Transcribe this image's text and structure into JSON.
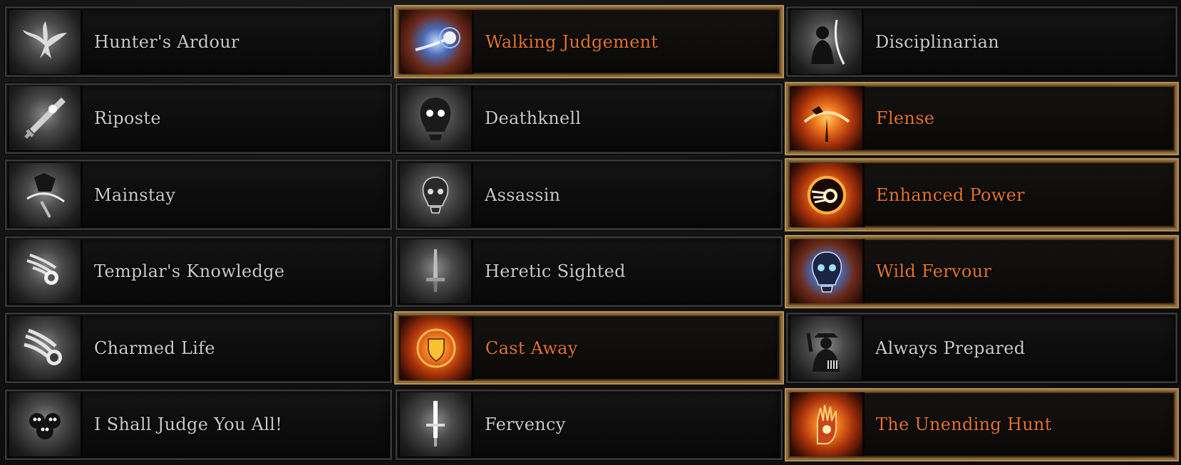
{
  "colors": {
    "inactive_text": "#c9c9c9",
    "active_text": "#e2732c",
    "active_border": "#b89258",
    "inactive_border": "#3a3a3a"
  },
  "perks": [
    {
      "label": "Hunter's Ardour",
      "icon": "dove-icon",
      "active": false
    },
    {
      "label": "Walking Judgement",
      "icon": "comet-icon",
      "active": true
    },
    {
      "label": "Disciplinarian",
      "icon": "silhouette-icon",
      "active": false
    },
    {
      "label": "Riposte",
      "icon": "sword-icon",
      "active": false
    },
    {
      "label": "Deathknell",
      "icon": "skull-glow-icon",
      "active": false
    },
    {
      "label": "Flense",
      "icon": "blade-arc-icon",
      "active": true
    },
    {
      "label": "Mainstay",
      "icon": "hooded-figure-icon",
      "active": false
    },
    {
      "label": "Assassin",
      "icon": "skull-icon",
      "active": false
    },
    {
      "label": "Enhanced Power",
      "icon": "fire-ring-icon",
      "active": true
    },
    {
      "label": "Templar's Knowledge",
      "icon": "fireball-icon",
      "active": false
    },
    {
      "label": "Heretic Sighted",
      "icon": "dagger-icon",
      "active": false
    },
    {
      "label": "Wild Fervour",
      "icon": "blue-skull-icon",
      "active": true
    },
    {
      "label": "Charmed Life",
      "icon": "meteor-icon",
      "active": false
    },
    {
      "label": "Cast Away",
      "icon": "shield-icon",
      "active": true
    },
    {
      "label": "Always Prepared",
      "icon": "gunslinger-icon",
      "active": false
    },
    {
      "label": "I Shall Judge You All!",
      "icon": "skull-cluster-icon",
      "active": false
    },
    {
      "label": "Fervency",
      "icon": "light-sword-icon",
      "active": false
    },
    {
      "label": "The Unending Hunt",
      "icon": "fiery-hand-icon",
      "active": true
    }
  ]
}
